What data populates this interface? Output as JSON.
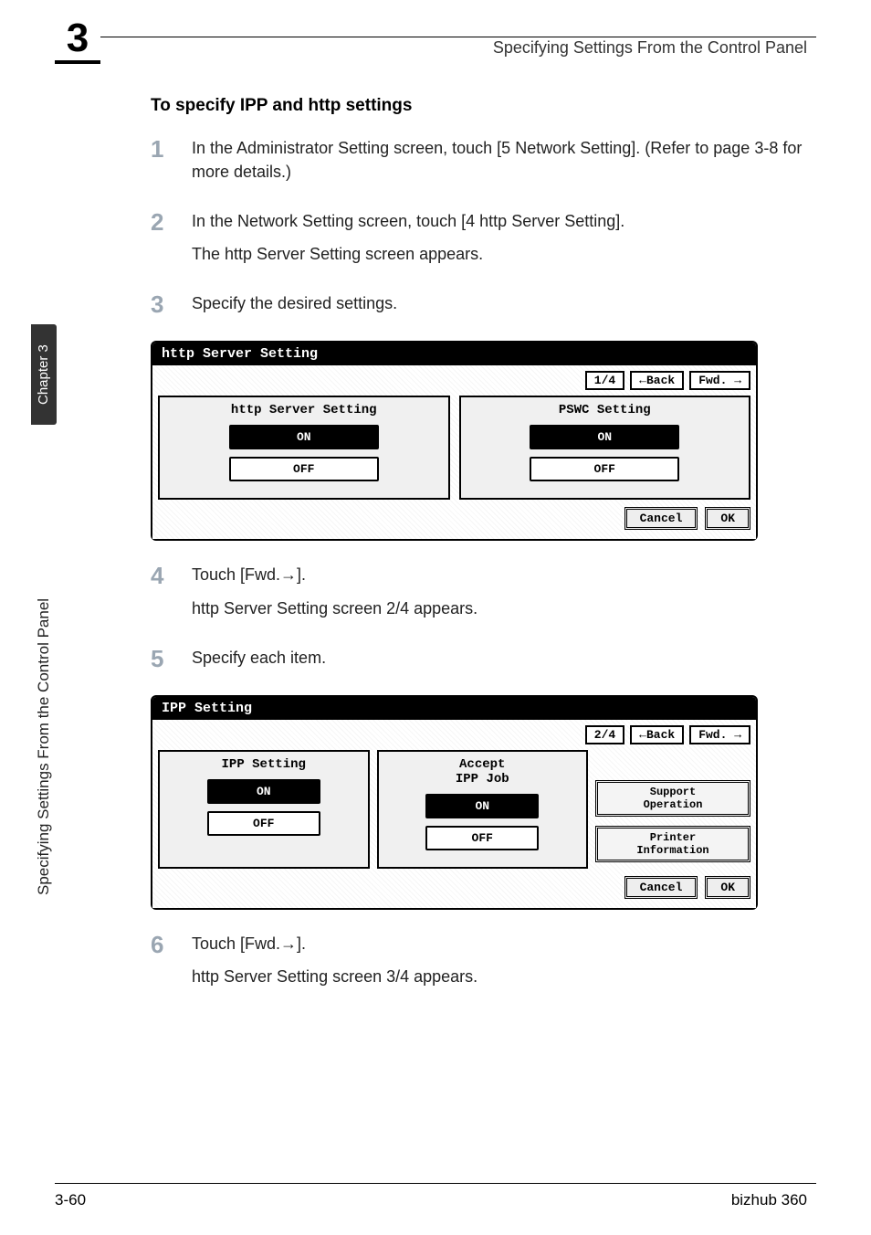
{
  "header": {
    "chapter_tab": "3",
    "running_head": "Specifying Settings From the Control Panel"
  },
  "sidebar": {
    "tab": "Chapter 3",
    "text": "Specifying Settings From the Control Panel"
  },
  "section_title": "To specify IPP and http settings",
  "steps": [
    {
      "num": "1",
      "lines": [
        "In the Administrator Setting screen, touch [5 Network Setting]. (Refer to page 3-8 for more details.)"
      ]
    },
    {
      "num": "2",
      "lines": [
        "In the Network Setting screen, touch [4 http Server Setting].",
        "The http Server Setting screen appears."
      ]
    },
    {
      "num": "3",
      "lines": [
        "Specify the desired settings."
      ]
    },
    {
      "num": "4",
      "lines": [
        "Touch [Fwd.→].",
        "http Server Setting screen 2/4 appears."
      ]
    },
    {
      "num": "5",
      "lines": [
        "Specify each item."
      ]
    },
    {
      "num": "6",
      "lines": [
        "Touch [Fwd.→].",
        "http Server Setting screen 3/4 appears."
      ]
    }
  ],
  "lcd1": {
    "title": "http Server Setting",
    "page": "1/4",
    "back": "←Back",
    "fwd": "Fwd. →",
    "panelA": {
      "title": "http Server Setting",
      "on": "ON",
      "off": "OFF"
    },
    "panelB": {
      "title": "PSWC Setting",
      "on": "ON",
      "off": "OFF"
    },
    "cancel": "Cancel",
    "ok": "OK"
  },
  "lcd2": {
    "title": "IPP Setting",
    "page": "2/4",
    "back": "←Back",
    "fwd": "Fwd. →",
    "panelA": {
      "title": "IPP Setting",
      "on": "ON",
      "off": "OFF"
    },
    "panelB": {
      "title": "Accept\nIPP Job",
      "on": "ON",
      "off": "OFF"
    },
    "side1": "Support\nOperation",
    "side2": "Printer\nInformation",
    "cancel": "Cancel",
    "ok": "OK"
  },
  "footer": {
    "page_num": "3-60",
    "model": "bizhub 360"
  }
}
